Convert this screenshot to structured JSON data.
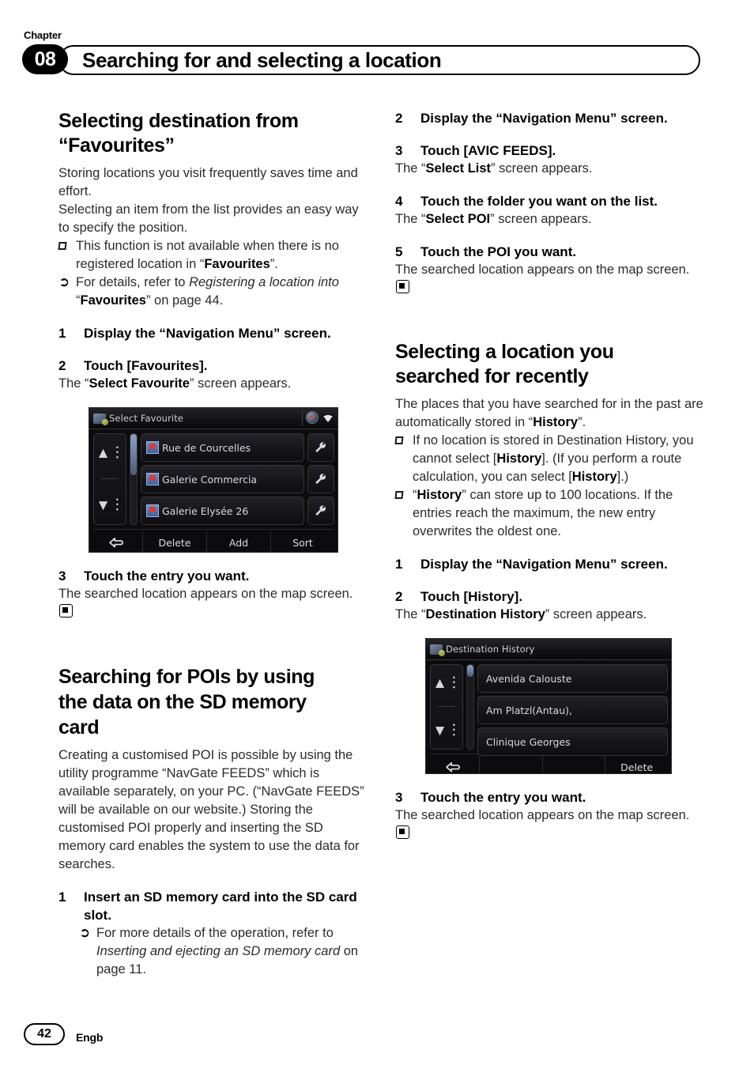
{
  "header": {
    "chapter_label": "Chapter",
    "chapter_number": "08",
    "title": "Searching for and selecting a location"
  },
  "left_column": {
    "section1": {
      "heading_line1": "Selecting destination from",
      "heading_line2": "“Favourites”",
      "intro1": "Storing locations you visit frequently saves time and effort.",
      "intro2": "Selecting an item from the list provides an easy way to specify the position.",
      "notes": [
        {
          "marker": "square-note-icon",
          "text_pre": "This function is not available when there is no registered location in “",
          "bold": "Favourites",
          "text_post": "”."
        }
      ],
      "refs": [
        {
          "marker": "arrow-reference-icon",
          "text_pre": "For details, refer to ",
          "italic1": "Registering a location into",
          "quote_open": " “",
          "bold": "Favourites",
          "quote_close": "”",
          "text_post": " on page 44."
        }
      ],
      "steps": [
        {
          "num": "1",
          "label": "Display the “Navigation Menu” screen.",
          "result_pre": "",
          "result_bold": "",
          "result_post": ""
        },
        {
          "num": "2",
          "label": "Touch [Favourites].",
          "result_pre": "The “",
          "result_bold": "Select Favourite",
          "result_post": "” screen appears."
        },
        {
          "num": "3",
          "label": "Touch the entry you want.",
          "result_pre": "The searched location appears on the map screen.",
          "result_bold": "",
          "result_post": ""
        }
      ]
    },
    "section2": {
      "heading_line1": "Searching for POIs by using",
      "heading_line2": "the data on the SD memory",
      "heading_line3": "card",
      "intro": "Creating a customised POI is possible by using the utility programme “NavGate FEEDS” which is available separately, on your PC. (“NavGate FEEDS” will be available on our website.) Storing the customised POI properly and inserting the SD memory card enables the system to use the data for searches.",
      "step1": {
        "num": "1",
        "label": "Insert an SD memory card into the SD card slot."
      },
      "ref": {
        "marker": "arrow-reference-icon",
        "text_pre": "For more details of the operation, refer to ",
        "italic": "Inserting and ejecting an SD memory card",
        "text_post": " on page 11."
      }
    }
  },
  "right_column": {
    "section1_steps": [
      {
        "num": "2",
        "label": "Display the “Navigation Menu” screen.",
        "result_pre": "",
        "result_bold": "",
        "result_post": ""
      },
      {
        "num": "3",
        "label": "Touch [AVIC FEEDS].",
        "result_pre": "The “",
        "result_bold": "Select List",
        "result_post": "” screen appears."
      },
      {
        "num": "4",
        "label": "Touch the folder you want on the list.",
        "result_pre": "The “",
        "result_bold": "Select POI",
        "result_post": "” screen appears."
      },
      {
        "num": "5",
        "label": "Touch the POI you want.",
        "result_pre": "The searched location appears on the map screen.",
        "result_bold": "",
        "result_post": ""
      }
    ],
    "section2": {
      "heading_line1": "Selecting a location you",
      "heading_line2": "searched for recently",
      "intro_pre": "The places that you have searched for in the past are automatically stored in “",
      "intro_bold": "History",
      "intro_post": "”.",
      "note1": {
        "marker": "square-note-icon",
        "p1": "If no location is stored in Destination History, you cannot select [",
        "b1": "History",
        "p2": "]. (If you perform a route calculation, you can select [",
        "b2": "History",
        "p3": "].)"
      },
      "note2": {
        "marker": "square-note-icon",
        "p1": "“",
        "b1": "History",
        "p2": "” can store up to 100 locations. If the entries reach the maximum, the new entry overwrites the oldest one."
      },
      "steps": [
        {
          "num": "1",
          "label": "Display the “Navigation Menu” screen.",
          "result_pre": "",
          "result_bold": "",
          "result_post": ""
        },
        {
          "num": "2",
          "label": "Touch [History].",
          "result_pre": "The “",
          "result_bold": "Destination History",
          "result_post": "” screen appears."
        },
        {
          "num": "3",
          "label": "Touch the entry you want.",
          "result_pre": "The searched location appears on the map screen.",
          "result_bold": "",
          "result_post": ""
        }
      ]
    }
  },
  "screenshots": {
    "select_favourite": {
      "title": "Select Favourite",
      "title_icon": "favourites-list-icon",
      "toolbar_icons": [
        "globe-icon",
        "download-arrow-icon"
      ],
      "scroll_up": "«",
      "scroll_down": "»",
      "items": [
        {
          "icon": "favourite-marker-icon",
          "label": "Rue de Courcelles",
          "action_icon": "wrench-icon"
        },
        {
          "icon": "favourite-marker-icon",
          "label": "Galerie Commercia",
          "action_icon": "wrench-icon"
        },
        {
          "icon": "favourite-marker-icon",
          "label": "Galerie Elysée 26",
          "action_icon": "wrench-icon"
        }
      ],
      "footer": {
        "back_icon": "back-arrow-icon",
        "buttons": [
          "Delete",
          "Add",
          "Sort"
        ]
      }
    },
    "destination_history": {
      "title": "Destination History",
      "title_icon": "destination-history-icon",
      "scroll_up": "«",
      "scroll_down": "»",
      "items": [
        {
          "label": "Avenida Calouste"
        },
        {
          "label": "Am Platzl(Antau),"
        },
        {
          "label": "Clinique Georges"
        }
      ],
      "footer": {
        "back_icon": "back-arrow-icon",
        "buttons": [
          "",
          "",
          "Delete"
        ]
      }
    }
  },
  "footer": {
    "page_number": "42",
    "language_code": "Engb"
  }
}
